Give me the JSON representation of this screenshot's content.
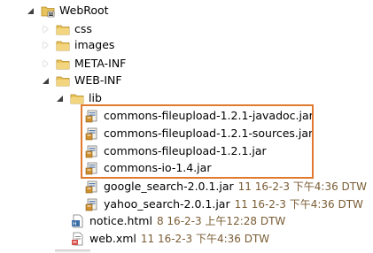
{
  "tree": {
    "webroot": {
      "label": "WebRoot"
    },
    "css": {
      "label": "css"
    },
    "images": {
      "label": "images"
    },
    "meta_inf": {
      "label": "META-INF"
    },
    "web_inf": {
      "label": "WEB-INF"
    },
    "lib": {
      "label": "lib"
    },
    "jars": [
      {
        "label": "commons-fileupload-1.2.1-javadoc.jar",
        "decoration": ""
      },
      {
        "label": "commons-fileupload-1.2.1-sources.jar",
        "decoration": ""
      },
      {
        "label": "commons-fileupload-1.2.1.jar",
        "decoration": ""
      },
      {
        "label": "commons-io-1.4.jar",
        "decoration": ""
      },
      {
        "label": "google_search-2.0.1.jar",
        "decoration": "11  16-2-3 下午4:36  DTW"
      },
      {
        "label": "yahoo_search-2.0.1.jar",
        "decoration": "11  16-2-3 下午4:36  DTW"
      }
    ],
    "notice": {
      "label": "notice.html",
      "decoration": "8  16-2-3 上午12:28  DTW"
    },
    "webxml": {
      "label": "web.xml",
      "decoration": "11  16-2-3 下午4:36  DTW"
    }
  },
  "colors": {
    "highlight_border": "#e07a2e",
    "decoration_text": "#7a5c34",
    "folder": "#e8c25a"
  },
  "icons": {
    "folder": "folder-icon",
    "jar": "jar-icon",
    "html": "html-file-icon",
    "xml": "xml-file-icon"
  }
}
